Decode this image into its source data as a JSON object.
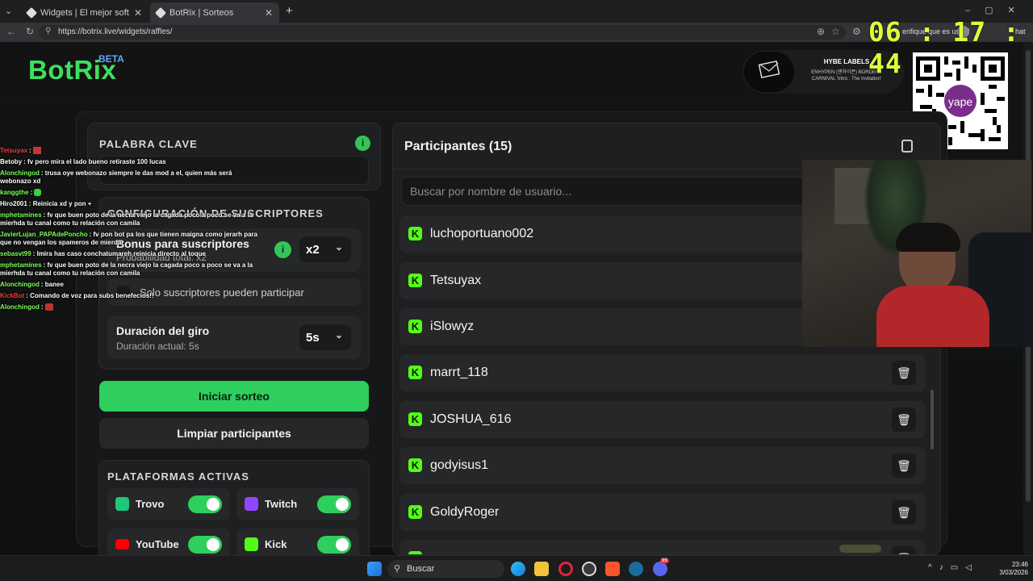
{
  "browser": {
    "tabs": [
      {
        "title": "Widgets | El mejor software para p"
      },
      {
        "title": "BotRix | Sorteos"
      }
    ],
    "url": "https://botrix.live/widgets/raffles/",
    "verify_hint": "erifique que es usted",
    "extra_label": "hat"
  },
  "header": {
    "logo": "BotRix",
    "beta": "BETA",
    "music": {
      "label": "HYBE LABELS",
      "song": "ENHYPEN (엔하이픈) BORDER : CARNIVAL 'Intro : The Invitation'"
    }
  },
  "keyword": {
    "title": "PALABRA CLAVE",
    "value": ""
  },
  "subs": {
    "title": "CONFIGURACIÓN DE SUSCRIPTORES",
    "bonus_title": "Bonus para suscriptores",
    "bonus_sub": "Probabilidad total: x2",
    "bonus_value": "x2",
    "only_subs": "Solo suscriptores pueden participar",
    "spin_title": "Duración del giro",
    "spin_sub": "Duración actual: 5s",
    "spin_value": "5s"
  },
  "actions": {
    "start": "Iniciar sorteo",
    "clear": "Limpiar participantes"
  },
  "platforms": {
    "title": "PLATAFORMAS ACTIVAS",
    "items": [
      {
        "name": "Trovo",
        "color": "#1ec77a",
        "enabled": true
      },
      {
        "name": "Twitch",
        "color": "#9146ff",
        "enabled": true
      },
      {
        "name": "YouTube",
        "color": "#ff0000",
        "enabled": true
      },
      {
        "name": "Kick",
        "color": "#53fc18",
        "enabled": true
      }
    ]
  },
  "participants": {
    "title": "Participantes (15)",
    "search_placeholder": "Buscar por nombre de usuario...",
    "list": [
      "luchoportuano002",
      "Tetsuyax",
      "iSlowyz",
      "marrt_118",
      "JOSHUA_616",
      "godyisus1",
      "GoldyRoger"
    ]
  },
  "overlay": {
    "clock": "06 : 17 : 44",
    "chat": [
      {
        "user": "Tetsuyax",
        "color": "#ff3b3b",
        "msg": ""
      },
      {
        "user": "Betoby",
        "color": "#ffffff",
        "msg": "fv pero mira el lado bueno retiraste 100 lucas"
      },
      {
        "user": "Alonchingod",
        "color": "#7dff5a",
        "msg": "trusa oye webonazo siempre le das mod a el, quien más será webonazo xd"
      },
      {
        "user": "kanggthe",
        "color": "#7dff5a",
        "msg": ""
      },
      {
        "user": "Hiro2001",
        "color": "#ffffff",
        "msg": "Reinicia xd y pon +"
      },
      {
        "user": "mphetamines",
        "color": "#7dff5a",
        "msg": "fv que buen poto de la necra viejo la cagada poco a poco se va a la mierhda tu canal como tu relación con camila"
      },
      {
        "user": "JavierLujan_PAPAdePoncho",
        "color": "#7dff5a",
        "msg": "fv pon bot pa los que tienen maigna como jerarh para que no vengan los spameros de mierda"
      },
      {
        "user": "sebasvt99",
        "color": "#7dff5a",
        "msg": "Imira has caso conchatumareh reinicia directo al toque"
      },
      {
        "user": "mphetamines",
        "color": "#7dff5a",
        "msg": "fv que buen poto de la necra viejo la cagada poco a poco se va a la mierhda tu canal como tu relación con camila"
      },
      {
        "user": "Alonchingod",
        "color": "#7dff5a",
        "msg": "banee"
      },
      {
        "user": "KickBot",
        "color": "#ff3b3b",
        "msg": "Comando de voz para subs benefecios!!"
      },
      {
        "user": "Alonchingod",
        "color": "#7dff5a",
        "msg": ""
      }
    ]
  },
  "taskbar": {
    "search": "Buscar",
    "time": "23:46",
    "date": "3/03/2026",
    "badge": "99"
  }
}
